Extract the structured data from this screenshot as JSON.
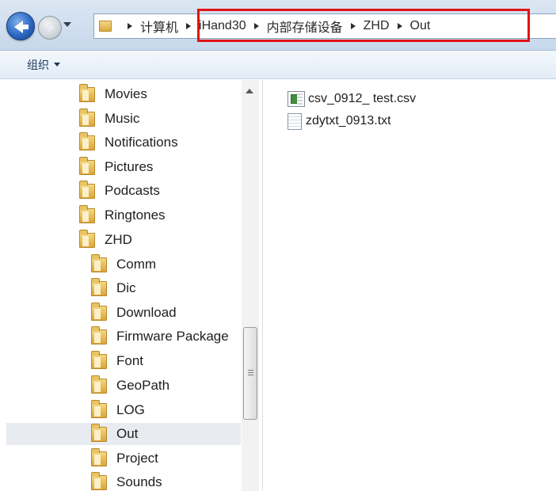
{
  "address_bar": {
    "breadcrumbs": [
      "计算机",
      "iHand30",
      "内部存储设备",
      "ZHD",
      "Out"
    ],
    "back_icon": "back-arrow-icon",
    "forward_icon": "forward-arrow-icon"
  },
  "toolbar": {
    "organize_label": "组织"
  },
  "nav_tree": {
    "items": [
      {
        "label": "Movies"
      },
      {
        "label": "Music"
      },
      {
        "label": "Notifications"
      },
      {
        "label": "Pictures"
      },
      {
        "label": "Podcasts"
      },
      {
        "label": "Ringtones"
      },
      {
        "label": "ZHD"
      },
      {
        "label": "Comm"
      },
      {
        "label": "Dic"
      },
      {
        "label": "Download"
      },
      {
        "label": "Firmware Package"
      },
      {
        "label": "Font"
      },
      {
        "label": "GeoPath"
      },
      {
        "label": "LOG"
      },
      {
        "label": "Out",
        "selected": true
      },
      {
        "label": "Project"
      },
      {
        "label": "Sounds"
      }
    ]
  },
  "files": [
    {
      "name": "csv_0912_ test.csv",
      "icon": "excel-csv-file-icon"
    },
    {
      "name": "zdytxt_0913.txt",
      "icon": "text-file-icon"
    }
  ],
  "colors": {
    "highlight_border": "#e21313",
    "selected_row": "#e8ebef"
  }
}
